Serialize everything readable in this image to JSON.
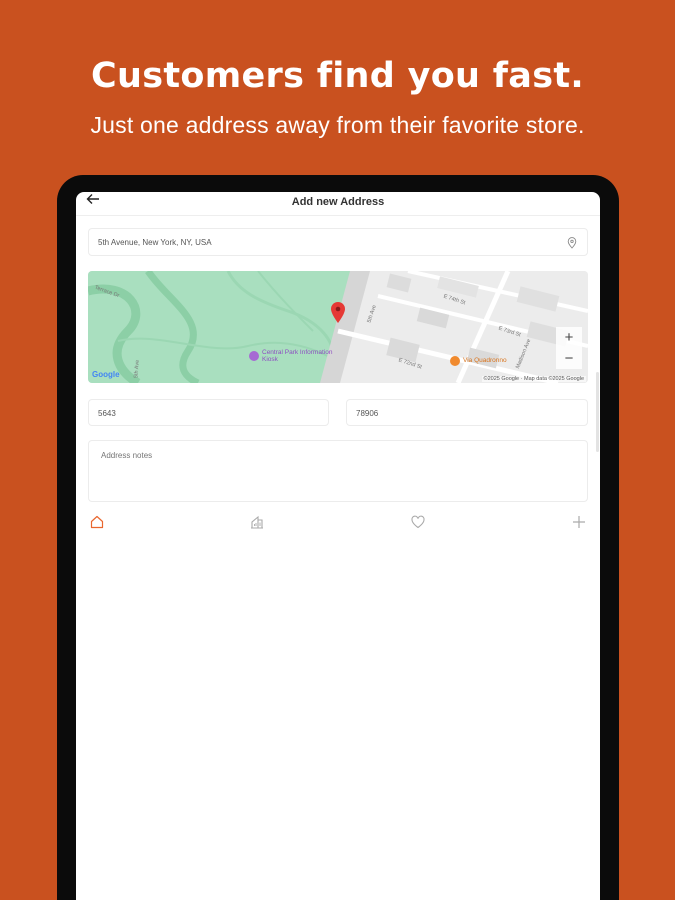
{
  "promo": {
    "headline": "Customers find you fast.",
    "subline": "Just one address away from their favorite store."
  },
  "appbar": {
    "title": "Add new Address",
    "back_icon": "arrow-left-icon"
  },
  "form": {
    "address_value": "5th Avenue, New York, NY, USA",
    "location_icon": "map-pin-icon",
    "number_value": "5643",
    "zip_value": "78906",
    "notes_placeholder": "Address notes"
  },
  "map": {
    "zoom_in": "+",
    "zoom_out": "−",
    "attribution": "©2025 Google · Map data ©2025 Google",
    "logo_text": "Google",
    "poi_central_park": "Central Park Information Kiosk",
    "poi_restaurant": "Via Quadronno",
    "streets": [
      "Terrace Dr",
      "5th Ave",
      "E 74th St",
      "E 73rd St",
      "E 72nd St",
      "Madison Ave",
      "5th Ave"
    ],
    "colors": {
      "park": "#A9DFBF",
      "water": "#7FB6CF",
      "road": "#ffffff",
      "block": "#e2e2e2",
      "pin": "#E53935"
    }
  },
  "address_types": [
    {
      "name": "home",
      "icon": "home-icon",
      "selected": true
    },
    {
      "name": "work",
      "icon": "building-icon",
      "selected": false
    },
    {
      "name": "favorite",
      "icon": "heart-icon",
      "selected": false
    },
    {
      "name": "add",
      "icon": "plus-icon",
      "selected": false
    }
  ],
  "colors": {
    "brand": "#C9511F",
    "accent": "#E9672F"
  }
}
